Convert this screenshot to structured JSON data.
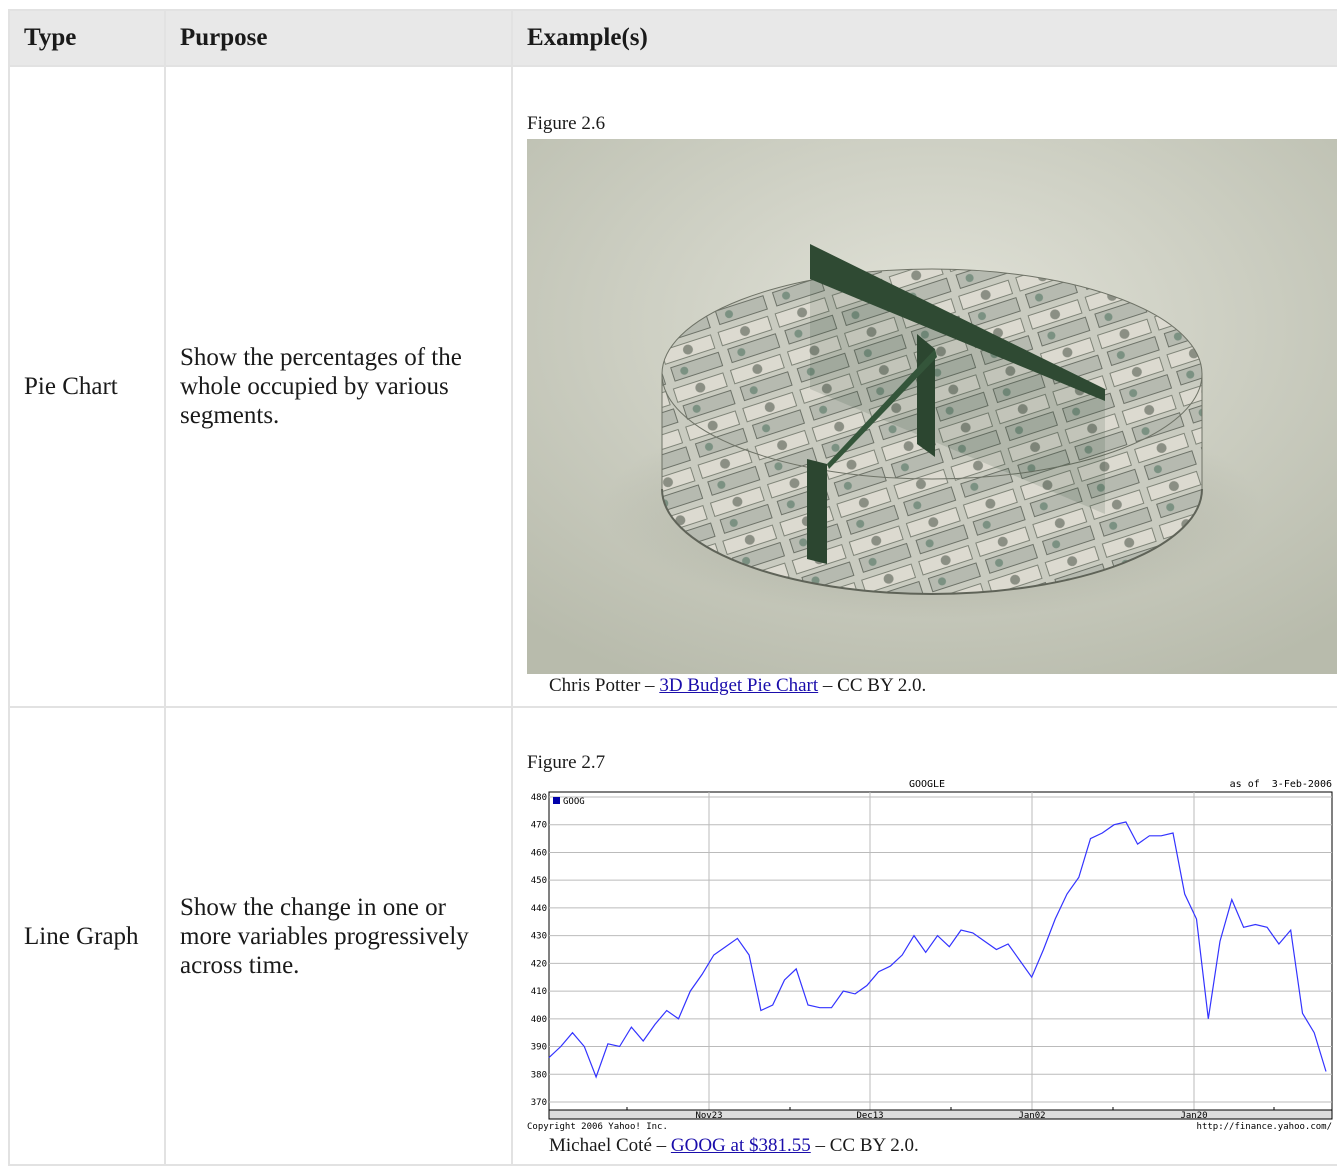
{
  "headers": {
    "type": "Type",
    "purpose": "Purpose",
    "examples": "Example(s)"
  },
  "rows": [
    {
      "type": "Pie Chart",
      "purpose": "Show the percentages of the whole occupied by various segments.",
      "figure_label": "Figure 2.6",
      "credit_author": "Chris Potter – ",
      "credit_link": "3D Budget Pie Chart",
      "credit_license": " – CC BY 2.0."
    },
    {
      "type": "Line Graph",
      "purpose": "Show the change in one or more variables progressively across time.",
      "figure_label": "Figure 2.7",
      "credit_author": "Michael Coté – ",
      "credit_link": "GOOG at $381.55",
      "credit_license": " – CC BY 2.0."
    }
  ],
  "chart_data": {
    "type": "line",
    "title": "GOOGLE",
    "as_of": "as of  3-Feb-2006",
    "legend": "GOOG",
    "copyright": "Copyright 2006 Yahoo! Inc.",
    "source_url": "http://finance.yahoo.com/",
    "ylim": [
      370,
      480
    ],
    "y_ticks": [
      370,
      380,
      390,
      400,
      410,
      420,
      430,
      440,
      450,
      460,
      470,
      480
    ],
    "x_tick_labels": [
      "Nov23",
      "Dec13",
      "Jan02",
      "Jan20"
    ],
    "line_color": "#3333ff",
    "grid": true,
    "series": [
      {
        "name": "GOOG",
        "values": [
          386,
          390,
          395,
          390,
          379,
          391,
          390,
          397,
          392,
          398,
          403,
          400,
          410,
          416,
          423,
          426,
          429,
          423,
          403,
          405,
          414,
          418,
          405,
          404,
          404,
          410,
          409,
          412,
          417,
          419,
          423,
          430,
          424,
          430,
          426,
          432,
          431,
          428,
          425,
          427,
          421,
          415,
          425,
          436,
          445,
          451,
          465,
          467,
          470,
          471,
          463,
          466,
          466,
          467,
          445,
          436,
          400,
          428,
          443,
          433,
          434,
          433,
          427,
          432,
          402,
          395,
          381
        ]
      }
    ]
  }
}
